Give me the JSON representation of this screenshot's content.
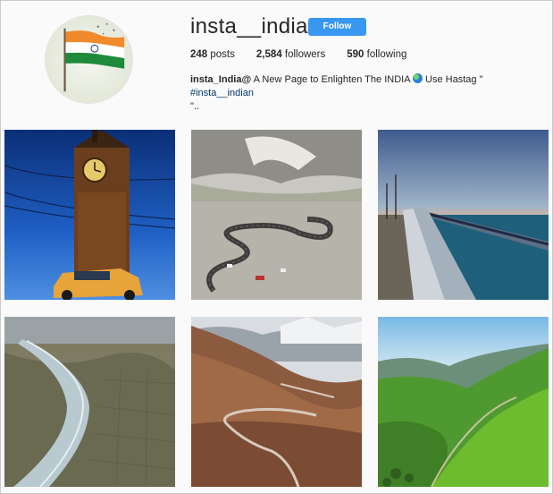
{
  "profile": {
    "username": "insta__indian",
    "follow_label": "Follow",
    "stats": {
      "posts_count": "248",
      "posts_label": "posts",
      "followers_count": "2,584",
      "followers_label": "followers",
      "following_count": "590",
      "following_label": "following"
    },
    "bio": {
      "handle": "insta_India@",
      "text": " A New Page to Enlighten The INDIA ",
      "text2": " Use Hastag \" ",
      "hashtag": "#insta__indian",
      "line2": "\".."
    }
  },
  "posts": [
    {
      "subject": "big-ben-reflection"
    },
    {
      "subject": "winding-mountain-road"
    },
    {
      "subject": "sea-bridge-sunset"
    },
    {
      "subject": "canal-aerial"
    },
    {
      "subject": "mountain-switchback-road"
    },
    {
      "subject": "green-valley"
    }
  ],
  "colors": {
    "follow_button": "#3897f0",
    "hashtag": "#003569",
    "text": "#262626",
    "background": "#fafafa"
  }
}
